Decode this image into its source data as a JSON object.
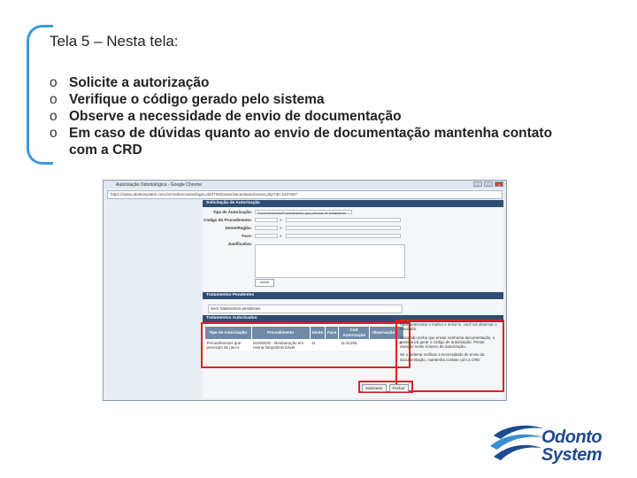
{
  "slide": {
    "title": "Tela 5 – Nesta tela:",
    "bullet_marker": "o",
    "bullets": [
      "Solicite a autorização",
      "Verifique o código gerado pelo sistema",
      "Observe  a necessidade de envio de documentação",
      "Em caso de dúvidas quanto ao envio de documentação mantenha contato",
      "com a CRD"
    ]
  },
  "screenshot": {
    "window_title": "Autorização Odontológica - Google Chrome",
    "address": "https://www.odontosystem.com.br/credenciados/login.php/TISS/autorizacao/autorizacao.php?ID=1637907",
    "section_request": "Solicitação de Autorização",
    "fields": {
      "type_label": "Tipo de Autorização:",
      "type_value": "Procedimentos/Procedimento que precisa de tratamento",
      "procedure_label": "Código do Procedimento:",
      "tooth_label": "Dente/Região:",
      "face_label": "Face:",
      "justification_label": "Justificativa:"
    },
    "add_button": "Incluir",
    "section_pending": "Tratamentos Pendentes",
    "pending_value": "Sem tratamentos pendentes",
    "section_authorized": "Tratamentos Autorizados",
    "table_headers": [
      "Tipo de Autorização",
      "Procedimento",
      "Dente",
      "Face",
      "Cod. Autorização",
      "Observação"
    ],
    "table_row": [
      "Procedimentos que precisam de raio-x",
      "81000030 - Restauração em resina fotopolimerizável",
      "11",
      "",
      "11-31255",
      ""
    ],
    "delete_icon": "close-icon",
    "tips": [
      "Após selecionar o motivo e incluí-lo, você vai observar o resultado.",
      "Caso não tenha que enviar nenhuma documentação, o sistema irá gerar o código de autorização. Preste atenção neste número de autorização.",
      "Se o sistema notificar a necessidade de envio da documentação, mantenha contato com a CRD."
    ],
    "button_submit": "Submeter",
    "button_close": "Fechar"
  },
  "logo": {
    "line1": "Odonto",
    "line2": "System"
  },
  "colors": {
    "accent": "#3a9ad9",
    "header": "#2f4e74",
    "table_head": "#6f8aa8",
    "highlight": "#e02020",
    "logo": "#1d4b8f"
  }
}
